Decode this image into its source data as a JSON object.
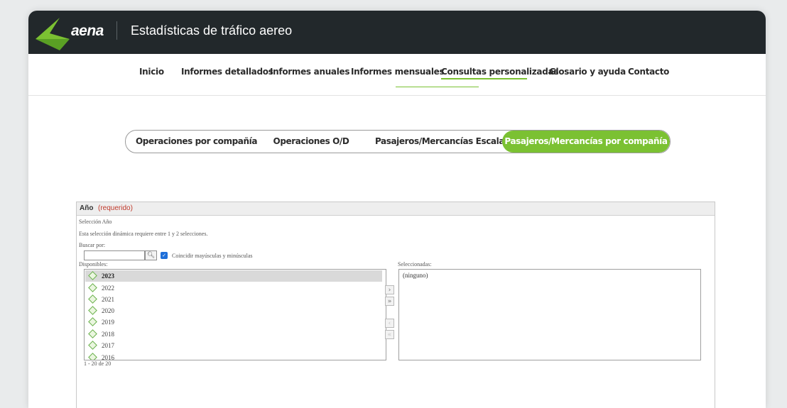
{
  "header": {
    "logo_text": "aena",
    "title": "Estadísticas de tráfico aereo",
    "brand_color": "#7bc132"
  },
  "nav": {
    "items": [
      {
        "label": "Inicio"
      },
      {
        "label": "Informes detallados"
      },
      {
        "label": "Informes anuales"
      },
      {
        "label": "Informes mensuales"
      },
      {
        "label": "Consultas personalizadas",
        "active": true
      },
      {
        "label": "Glosario y ayuda"
      },
      {
        "label": "Contacto"
      }
    ]
  },
  "tabs": [
    {
      "label": "Operaciones por compañía"
    },
    {
      "label": "Operaciones O/D"
    },
    {
      "label": "Pasajeros/Mercancías Escala"
    },
    {
      "label": "Pasajeros/Mercancías por compañía",
      "active": true
    }
  ],
  "panel": {
    "title": "Año",
    "required": "(requerido)",
    "selection_label": "Selección Año",
    "hint": "Esta selección dinámica requiere entre 1 y 2 selecciones.",
    "search_label": "Buscar por:",
    "search_value": "",
    "match_case_label": "Coincidir mayúsculas y minúsculas",
    "match_case_checked": true,
    "available_label": "Disponibles:",
    "selected_label": "Seleccionadas:",
    "available": [
      "2023",
      "2022",
      "2021",
      "2020",
      "2019",
      "2018",
      "2017",
      "2016"
    ],
    "selected_placeholder": "(ninguno)",
    "pager": "1 - 20 de 20",
    "buttons": {
      "add": "›",
      "add_all": "»",
      "remove": "‹",
      "remove_all": "«"
    }
  }
}
